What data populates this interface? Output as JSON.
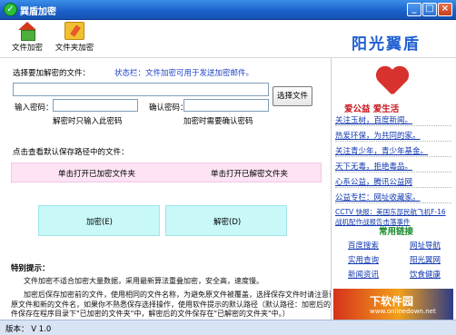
{
  "window": {
    "title": "巽盾加密",
    "app_icon": "check-shield-icon",
    "minimize": "_",
    "maximize": "□",
    "close": "×"
  },
  "toolbar": {
    "file_encrypt": {
      "label": "文件加密",
      "icon": "house-icon"
    },
    "folder_encrypt": {
      "label": "文件夹加密",
      "icon": "folder-pencil-icon"
    }
  },
  "brand": "阳光翼盾",
  "form": {
    "select_label": "选择要加解密的文件：",
    "status_label": "状态栏：文件加密可用于发送加密邮件。",
    "file_path_value": "",
    "select_button": "选择文件",
    "password_label": "输入密码：",
    "password_value": "",
    "confirm_label": "确认密码：",
    "confirm_value": "",
    "password_hint": "解密时只输入此密码",
    "confirm_hint": "加密时需要确认密码",
    "default_path_label": "点击查看默认保存路径中的文件：",
    "open_encrypted_folder": "单击打开已加密文件夹",
    "open_decrypted_folder": "单击打开已解密文件夹",
    "encrypt_button": "加密(E)",
    "decrypt_button": "解密(D)"
  },
  "tips": {
    "heading": "特别提示：",
    "lines": [
      "文件加密不适合加密大量数据，采用最新算法重叠加密，安全高，速度慢。",
      "加密后保存加密前的文件，使用相同的文件名称，为避免原文件被覆盖，选择保存文件时请注意调整保存",
      "原文件和新的文件名，如果你不熟悉保存选择操作，使用软件提示的默认路径（默认路径：加密后的文",
      "件保存在程序目录下\"已加密的文件夹\"中，解密后的文件保存在\"已解密的文件夹\"中。）"
    ]
  },
  "side": {
    "slogan": "爱公益  爱生活",
    "links": [
      "关注玉树，百度新闻。",
      "热爱环保，为共同的家。",
      "关注青少年，青少年基金。",
      "天下无毒，拒绝毒品。",
      "心系公益，腾讯公益网",
      "公益专栏：网址收藏家。",
      "CCTV 快报：美国东部民航飞机F-16战机配作战报告击落事件"
    ],
    "common_title": "常用链接",
    "grid": [
      "百度搜索",
      "网址导航",
      "实用查询",
      "阳光翼网",
      "新闻资讯",
      "饮食健康"
    ],
    "ad_title": "下软件园",
    "ad_sub": "www.onlinedown.net"
  },
  "status_bar": {
    "version": "版本： V 1.0"
  }
}
